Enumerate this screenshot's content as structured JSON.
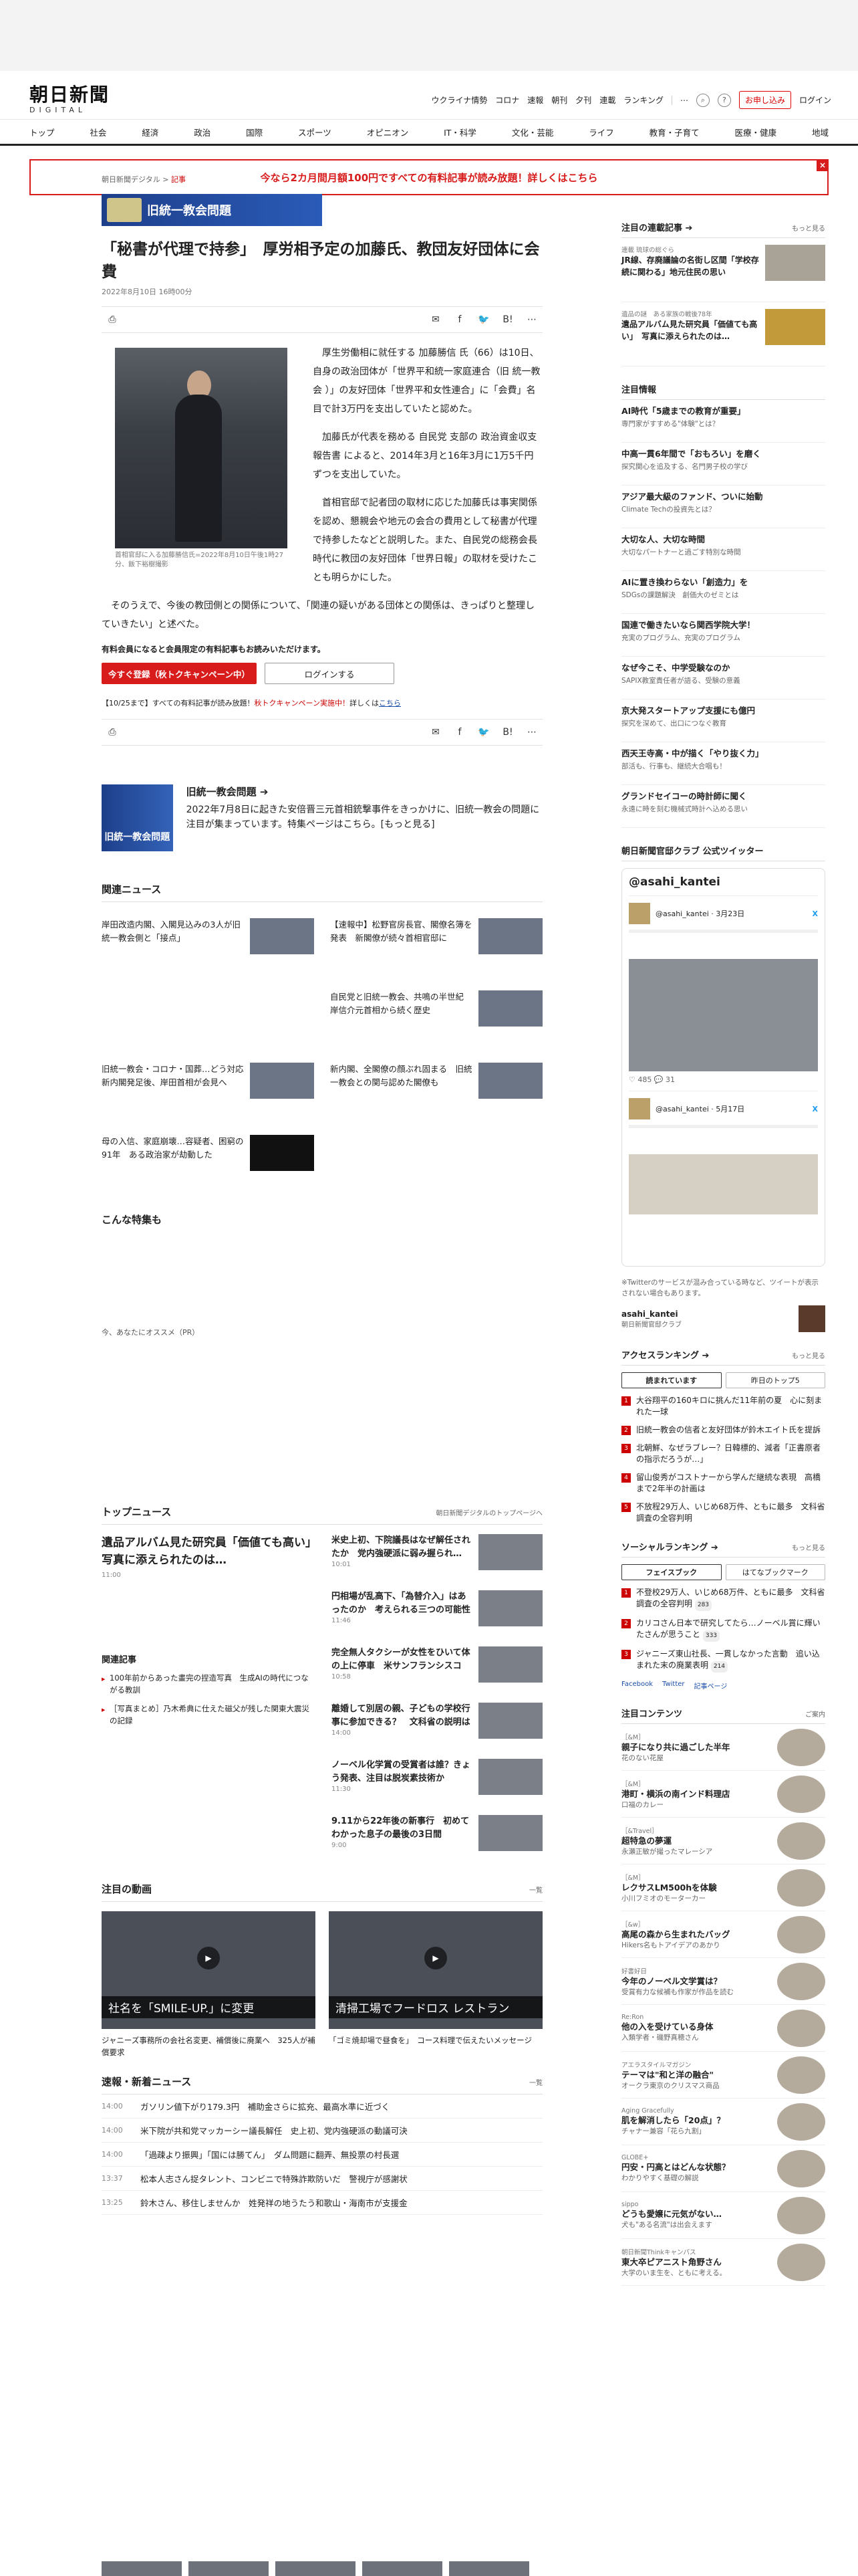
{
  "header": {
    "logo_main": "朝日新聞",
    "logo_sub": "DIGITAL",
    "util_links": [
      "ウクライナ情勢",
      "コロナ",
      "速報",
      "朝刊",
      "夕刊",
      "連載",
      "ランキング"
    ],
    "more": "⋯",
    "subscribe": "お申し込み",
    "login": "ログイン"
  },
  "nav": [
    "トップ",
    "社会",
    "経済",
    "政治",
    "国際",
    "スポーツ",
    "オピニオン",
    "IT・科学",
    "文化・芸能",
    "ライフ",
    "教育・子育て",
    "医療・健康",
    "地域"
  ],
  "campaign": {
    "text": "今なら2カ月間月額100円ですべての有料記事が読み放題！詳しくはこちら",
    "close": "×"
  },
  "article": {
    "breadcrumb_site": "朝日新聞デジタル",
    "breadcrumb_sep": ">",
    "breadcrumb_section": "記事",
    "banner": "旧統一教会問題",
    "title": "「秘書が代理で持参」　厚労相予定の加藤氏、教団友好団体に会費",
    "date": "2022年8月10日 16時00分",
    "photo_caption": "首相官邸に入る加藤勝信氏=2022年8月10日午後1時27分、飯下裕樹撮影",
    "paragraphs": [
      "厚生労働相に就任する 加藤勝信 氏（66）は10日、自身の政治団体が「世界平和統一家庭連合（旧 統一教会 ）」の友好団体「世界平和女性連合」に「会費」名目で計3万円を支出していたと認めた。",
      "加藤氏が代表を務める 自民党 支部の 政治資金収支報告書 によると、2014年3月と16年3月に1万5千円ずつを支出していた。",
      "首相官邸で記者団の取材に応じた加藤氏は事実関係を認め、懇親会や地元の会合の費用として秘書が代理で持参したなどと説明した。また、自民党の総務会長時代に教団の友好団体「世界日報」の取材を受けたことも明らかにした。",
      "そのうえで、今後の教団側との関係について、「関連の疑いがある団体との関係は、きっぱりと整理していきたい」と述べた。"
    ],
    "paywall_msg": "有料会員になると会員限定の有料記事もお読みいただけます。",
    "btn_register": "今すぐ登録（秋トクキャンペーン中）",
    "btn_login": "ログインする",
    "promo_prefix": "【10/25まで】すべての有料記事が読み放題！",
    "promo_red": "秋トクキャンペーン実施中！",
    "promo_link_pre": "詳しくは",
    "promo_link": "こちら",
    "list_label": "list",
    "share_count": "0"
  },
  "feature": {
    "thumb": "旧統一教会問題",
    "title": "旧統一教会問題 ➔",
    "desc": "2022年7月8日に起きた安倍晋三元首相銃撃事件をきっかけに、旧統一教会の問題に注目が集まっています。特集ページはこちら。[もっと見る]"
  },
  "related": {
    "title": "関連ニュース",
    "items": [
      "岸田改造内閣、入閣見込みの3人が旧統一教会側と「接点」",
      "【速報中】松野官房長官、閣僚名簿を発表　新閣僚が続々首相官邸に",
      "",
      "自民党と旧統一教会、共鳴の半世紀　岸信介元首相から続く歴史",
      "旧統一教会・コロナ・国葬…どう対応　新内閣発足後、岸田首相が会見へ",
      "新内閣、全閣僚の顔ぶれ固まる　旧統一教会との関与認めた閣僚も",
      "母の入信、家庭崩壊…容疑者、困窮の91年　ある政治家が劫動した",
      ""
    ]
  },
  "special_title": "こんな特集も",
  "recom_label": "今、あなたにオススメ（PR）",
  "topnews": {
    "title": "トップニュース",
    "more": "朝日新聞デジタルのトップページへ",
    "lead": "遺品アルバム見た研究員「価値ても高い」　写真に添えられたのは…",
    "lead_time": "11:00",
    "items": [
      {
        "t": "米史上初、下院議長はなぜ解任されたか　党内強硬派に弱み握られ…",
        "tm": "10:01"
      },
      {
        "t": "円相場が乱高下、「為替介入」はあったのか　考えられる三つの可能性",
        "tm": "11:46"
      },
      {
        "t": "完全無人タクシーが女性をひいて体の上に停車　米サンフランシスコ",
        "tm": "10:58"
      },
      {
        "t": "離婚して別居の親、子どもの学校行事に参加できる？　文科省の説明は",
        "tm": "14:00"
      },
      {
        "t": "ノーベル化学賞の受賞者は誰？きょう発表、注目は脱炭素技術か",
        "tm": "11:30"
      },
      {
        "t": "9.11から22年後の新事行　初めてわかった息子の最後の3日間",
        "tm": "9:00"
      }
    ],
    "related_title": "関連記事",
    "related": [
      "100年前からあった畫完の捏造写真　生成AIの時代につながる教訓",
      "［写真まとめ］乃木希典に仕えた磁父が残した関東大震災の記録"
    ]
  },
  "videos": {
    "title": "注目の動画",
    "more": "一覧",
    "items": [
      {
        "ov": "社名を「SMILE-UP.」に変更",
        "cap": "ジャニーズ事務所の会社名変更、補償後に廃業へ　325人が補償要求"
      },
      {
        "ov": "清掃工場でフードロス レストラン",
        "cap": "「ゴミ焼却場で昼食を」　コース料理で伝えたいメッセージ"
      }
    ]
  },
  "breaking": {
    "title": "速報・新着ニュース",
    "more": "一覧",
    "items": [
      {
        "tm": "14:00",
        "t": "ガソリン値下がり179.3円　補助金さらに拡充、最高水準に近づく"
      },
      {
        "tm": "14:00",
        "t": "米下院が共和党マッカーシー議長解任　史上初、党内強硬派の動議可決"
      },
      {
        "tm": "14:00",
        "t": "「過疎より振興」「国には勝てん」　ダム問題に翻弄、無投票の村長選"
      },
      {
        "tm": "13:37",
        "t": "松本人志さん捉タレント、コンビニで特殊詐欺防いだ　警視庁が感謝状"
      },
      {
        "tm": "13:25",
        "t": "鈴木さん、移住しませんか　姓発祥の地うたう和歌山・海南市が支援金"
      }
    ]
  },
  "side": {
    "serial_title": "注目の連載記事 ➔",
    "serial_more": "もっと見る",
    "serial": [
      {
        "meta": "連載 琉球の総ぐら",
        "t": "JR線、存廃議論の名街し区間「学校存続に関わる」地元住民の思い"
      },
      {
        "meta": "遺品の謎　ある家族の戦後78年",
        "t": "遺品アルバム見た研究員「価値ても高い」　写真に添えられたのは…"
      }
    ],
    "attn_title": "注目情報",
    "attn": [
      {
        "t": "AI時代「5歳までの教育が重要」",
        "s": "専門家がすすめる\"体験\"とは？"
      },
      {
        "t": "中高一貫6年間で「おもろい」を磨く",
        "s": "探究関心を追及する、名門男子校の学び"
      },
      {
        "t": "アジア最大級のファンド、ついに始動",
        "s": "Climate Techの投資先とは？"
      },
      {
        "t": "大切な人、大切な時間",
        "s": "大切なパートナーと過ごす特別な時間"
      },
      {
        "t": "AIに置き換わらない「創造力」を",
        "s": "SDGsの課題解決　創価大のゼミとは"
      },
      {
        "t": "国連で働きたいなら関西学院大学！",
        "s": "充実のプログラム、充実のプログラム"
      },
      {
        "t": "なぜ今こそ、中学受験なのか",
        "s": "SAPIX教室責任者が語る、受験の意義"
      },
      {
        "t": "京大発スタートアップ支援にも億円",
        "s": "探究を深めて、出口につなぐ教育"
      },
      {
        "t": "西天王寺高・中が描く「やり抜く力」",
        "s": "部活も、行事も、継続大合唱も！"
      },
      {
        "t": "グランドセイコーの時計師に聞く",
        "s": "永遠に時を刻む機械式時計へ込める思い"
      }
    ],
    "twitter_title": "朝日新聞官邸クラブ 公式ツイッター",
    "tw_handle": "@asahi_kantei",
    "tw_user1": "@asahi_kantei · 3月23日",
    "tw_user2": "@asahi_kantei · 5月17日",
    "tw_foot": "♡ 485  💬 31",
    "tw_note": "※Twitterのサービスが混み合っている時など、ツイートが表示されない場合もあります。",
    "tw_acct": "asahi_kantei",
    "tw_acct_sub": "朝日新聞官邸クラブ",
    "ranking_title": "アクセスランキング ➔",
    "ranking_more": "もっと見る",
    "tab1": "読まれています",
    "tab2": "昨日のトップ5",
    "ranking": [
      "大谷翔平の160キロに挑んだ11年前の夏　心に刻まれた一球",
      "旧統一教会の信者と友好団体が鈴木エイト氏を提訴",
      "北朝鮮、なぜラブレー？日韓標的、減者「正書原者の指示だろうが…」",
      "留山俊秀がコストナーから学んだ継続な表現　高橋まで2年半の計画は",
      "不放程29万人、いじめ68万件、ともに最多　文科省調査の全容判明"
    ],
    "social_title": "ソーシャルランキング ➔",
    "social_more": "もっと見る",
    "social_tab1": "フェイスブック",
    "social_tab2": "はてなブックマーク",
    "social": [
      {
        "t": "不登校29万人、いじめ68万件、ともに最多　文科省調査の全容判明",
        "c": "283"
      },
      {
        "t": "カリコさん日本で研究してたら…ノーベル賞に輝いたさんが思うこと",
        "c": "333"
      },
      {
        "t": "ジャニーズ東山社長、一貫しなかった言動　追い込まれた末の廃業表明",
        "c": "214"
      }
    ],
    "social_links": [
      "Facebook",
      "Twitter",
      "記事ページ"
    ],
    "content_title": "注目コンテンツ",
    "content_more": "ご案内",
    "contents": [
      {
        "tag": "［&M］",
        "t": "親子になり共に過ごした半年",
        "s": "花のない花屋"
      },
      {
        "tag": "［&M］",
        "t": "港町・横浜の南インド料理店",
        "s": "口福のカレー"
      },
      {
        "tag": "［&Travel］",
        "t": "超特急の夢運",
        "s": "永瀬正敏が撮ったマレーシア"
      },
      {
        "tag": "［&M］",
        "t": "レクサスLM500hを体験",
        "s": "小川フミオのモーターカー"
      },
      {
        "tag": "［&w］",
        "t": "高尾の森から生まれたバッグ",
        "s": "Hikers名もトアイデアのあかり"
      },
      {
        "tag": "好書好日",
        "t": "今年のノーベル文学賞は？",
        "s": "受賞有力な候補も作家が作品を読む"
      },
      {
        "tag": "Re:Ron",
        "t": "他の入を受けている身体",
        "s": "入類学者・磯野真穂さん"
      },
      {
        "tag": "アエラスタイルマガジン",
        "t": "テーマは\"和と洋の融合\"",
        "s": "オークラ東京のクリスマス商品"
      },
      {
        "tag": "Aging Gracefully",
        "t": "肌を解消したら「20点」？",
        "s": "チャナー兼容「花ら九割」"
      },
      {
        "tag": "GLOBE+",
        "t": "円安・円高とはどんな状態？",
        "s": "わかりやすく基礎の解説"
      },
      {
        "tag": "sippo",
        "t": "どうも愛嬢に元気がない…",
        "s": "犬も\"ある名流\"は出会えます"
      },
      {
        "tag": "朝日新聞Thinkキャンパス",
        "t": "東大卒ピアニスト角野さん",
        "s": "大学のいま生を、ともに考える。"
      }
    ]
  }
}
